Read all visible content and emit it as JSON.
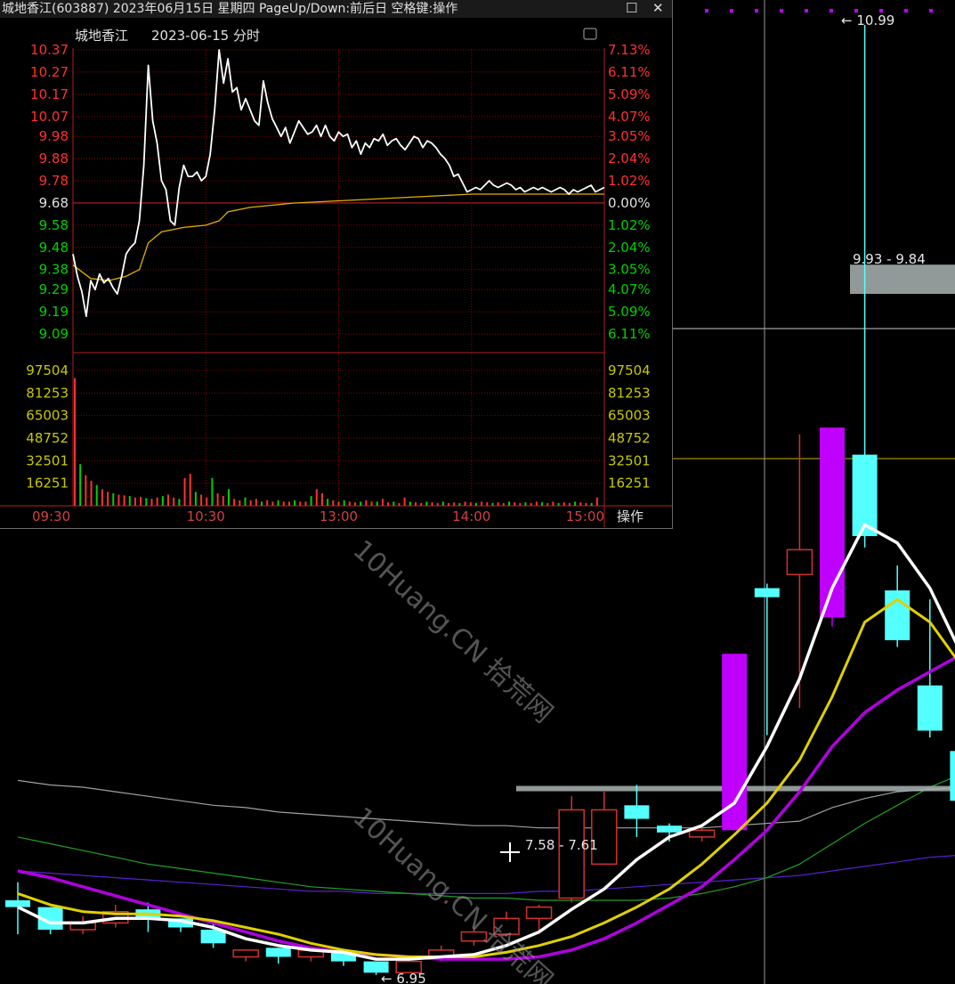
{
  "popup": {
    "title": "城地香江(603887) 2023年06月15日 星期四 PageUp/Down:前后日 空格键:操作",
    "header_name": "城地香江",
    "header_date": "2023-06-15 分时",
    "close_glyph": "✕",
    "restore_glyph": "☐",
    "op_label": "操作"
  },
  "watermark": "10Huang.CN 拾荒网",
  "colors": {
    "up": "#ff3030",
    "down": "#00d000",
    "up_candle": "#d23030",
    "down_candle": "#54ffff",
    "limit_up": "#c000ff",
    "price": "#ffffff",
    "avg": "#e0b000",
    "ma5": "#ffffff",
    "ma10": "#e0d000",
    "ma20": "#b000e0",
    "grid": "#8b0000"
  },
  "chart_data": [
    {
      "type": "line",
      "title": "城地香江 2023-06-15 分时",
      "x_ticks": [
        "09:30",
        "10:30",
        "13:00",
        "14:00",
        "15:00"
      ],
      "prev_close": 9.68,
      "price_ticks": [
        "10.37",
        "10.27",
        "10.17",
        "10.07",
        "9.98",
        "9.88",
        "9.78",
        "9.68",
        "9.58",
        "9.48",
        "9.38",
        "9.29",
        "9.19",
        "9.09"
      ],
      "pct_ticks": [
        "7.13%",
        "6.11%",
        "5.09%",
        "4.07%",
        "3.05%",
        "2.04%",
        "1.02%",
        "0.00%",
        "1.02%",
        "2.04%",
        "3.05%",
        "4.07%",
        "5.09%",
        "6.11%"
      ],
      "volume_ticks": [
        "97504",
        "81253",
        "65003",
        "48752",
        "32501",
        "16251"
      ],
      "series": [
        {
          "values": [
            [
              0,
              9.45
            ],
            [
              2,
              9.35
            ],
            [
              4,
              9.28
            ],
            [
              6,
              9.17
            ],
            [
              8,
              9.33
            ],
            [
              10,
              9.29
            ],
            [
              12,
              9.36
            ],
            [
              14,
              9.32
            ],
            [
              16,
              9.34
            ],
            [
              18,
              9.3
            ],
            [
              20,
              9.27
            ],
            [
              22,
              9.35
            ],
            [
              24,
              9.45
            ],
            [
              26,
              9.48
            ],
            [
              28,
              9.5
            ],
            [
              30,
              9.6
            ],
            [
              32,
              9.85
            ],
            [
              34,
              10.3
            ],
            [
              36,
              10.05
            ],
            [
              38,
              9.95
            ],
            [
              40,
              9.78
            ],
            [
              42,
              9.74
            ],
            [
              44,
              9.6
            ],
            [
              46,
              9.58
            ],
            [
              48,
              9.75
            ],
            [
              50,
              9.85
            ],
            [
              52,
              9.8
            ],
            [
              54,
              9.8
            ],
            [
              56,
              9.82
            ],
            [
              58,
              9.78
            ],
            [
              60,
              9.8
            ],
            [
              62,
              9.9
            ],
            [
              64,
              10.1
            ],
            [
              66,
              10.37
            ],
            [
              68,
              10.22
            ],
            [
              70,
              10.33
            ],
            [
              72,
              10.18
            ],
            [
              74,
              10.2
            ],
            [
              76,
              10.1
            ],
            [
              78,
              10.15
            ],
            [
              80,
              10.1
            ],
            [
              82,
              10.05
            ],
            [
              84,
              10.03
            ],
            [
              86,
              10.23
            ],
            [
              88,
              10.13
            ],
            [
              90,
              10.06
            ],
            [
              92,
              10.02
            ],
            [
              94,
              9.98
            ],
            [
              96,
              10.02
            ],
            [
              98,
              9.95
            ],
            [
              100,
              10.0
            ],
            [
              102,
              10.05
            ],
            [
              104,
              10.02
            ],
            [
              106,
              9.99
            ],
            [
              108,
              10.0
            ],
            [
              110,
              10.03
            ],
            [
              112,
              9.98
            ],
            [
              114,
              10.03
            ],
            [
              116,
              9.98
            ],
            [
              118,
              9.96
            ],
            [
              120,
              10.0
            ],
            [
              122,
              9.98
            ],
            [
              124,
              9.99
            ],
            [
              126,
              9.93
            ],
            [
              128,
              9.96
            ],
            [
              130,
              9.9
            ],
            [
              132,
              9.95
            ],
            [
              134,
              9.93
            ],
            [
              136,
              9.97
            ],
            [
              138,
              9.96
            ],
            [
              140,
              9.99
            ],
            [
              142,
              9.94
            ],
            [
              144,
              9.96
            ],
            [
              146,
              9.97
            ],
            [
              148,
              9.94
            ],
            [
              150,
              9.92
            ],
            [
              152,
              9.95
            ],
            [
              154,
              9.98
            ],
            [
              156,
              9.97
            ],
            [
              158,
              9.93
            ],
            [
              160,
              9.96
            ],
            [
              162,
              9.95
            ],
            [
              164,
              9.93
            ],
            [
              166,
              9.9
            ],
            [
              168,
              9.88
            ],
            [
              170,
              9.85
            ],
            [
              172,
              9.8
            ],
            [
              174,
              9.81
            ],
            [
              176,
              9.77
            ],
            [
              178,
              9.73
            ],
            [
              180,
              9.74
            ],
            [
              182,
              9.75
            ],
            [
              184,
              9.74
            ],
            [
              186,
              9.76
            ],
            [
              188,
              9.78
            ],
            [
              190,
              9.76
            ],
            [
              192,
              9.75
            ],
            [
              194,
              9.76
            ],
            [
              196,
              9.77
            ],
            [
              198,
              9.76
            ],
            [
              200,
              9.74
            ],
            [
              202,
              9.75
            ],
            [
              204,
              9.73
            ],
            [
              206,
              9.74
            ],
            [
              208,
              9.75
            ],
            [
              210,
              9.74
            ],
            [
              212,
              9.75
            ],
            [
              214,
              9.74
            ],
            [
              216,
              9.73
            ],
            [
              218,
              9.74
            ],
            [
              220,
              9.75
            ],
            [
              222,
              9.74
            ],
            [
              224,
              9.72
            ],
            [
              226,
              9.74
            ],
            [
              228,
              9.73
            ],
            [
              230,
              9.74
            ],
            [
              232,
              9.75
            ],
            [
              234,
              9.76
            ],
            [
              236,
              9.73
            ],
            [
              238,
              9.74
            ],
            [
              240,
              9.75
            ]
          ]
        },
        {
          "values": [
            [
              0,
              9.4
            ],
            [
              8,
              9.34
            ],
            [
              16,
              9.33
            ],
            [
              24,
              9.35
            ],
            [
              30,
              9.38
            ],
            [
              34,
              9.5
            ],
            [
              40,
              9.55
            ],
            [
              50,
              9.57
            ],
            [
              60,
              9.58
            ],
            [
              66,
              9.6
            ],
            [
              70,
              9.64
            ],
            [
              80,
              9.66
            ],
            [
              100,
              9.68
            ],
            [
              120,
              9.69
            ],
            [
              140,
              9.7
            ],
            [
              160,
              9.71
            ],
            [
              180,
              9.72
            ],
            [
              200,
              9.72
            ],
            [
              220,
              9.72
            ],
            [
              240,
              9.72
            ]
          ]
        }
      ],
      "volume": [
        92000,
        30000,
        22000,
        18000,
        15000,
        12000,
        10000,
        9000,
        8000,
        7500,
        7000,
        6000,
        6500,
        5500,
        5000,
        6000,
        7000,
        8000,
        6000,
        5000,
        20000,
        23000,
        10000,
        8000,
        6000,
        20000,
        9000,
        7000,
        12000,
        5000,
        4000,
        6000,
        4000,
        5000,
        3000,
        4000,
        3000,
        4000,
        3000,
        3000,
        4000,
        3000,
        3000,
        7000,
        12000,
        9000,
        5000,
        4000,
        3000,
        4000,
        3000,
        2500,
        3000,
        4000,
        3000,
        3000,
        5000,
        2500,
        3000,
        2000,
        6000,
        3000,
        2500,
        2000,
        3000,
        2500,
        2000,
        3000,
        2000,
        2500,
        2000,
        3000,
        2500,
        2000,
        3000,
        2500,
        2000,
        2500,
        2000,
        3000,
        2500,
        2000,
        2500,
        2000,
        3000,
        2500,
        2000,
        3000,
        2000,
        2500,
        2000,
        3000,
        2500,
        2000,
        2000,
        6000
      ]
    },
    {
      "type": "candlestick",
      "price_labels": [
        {
          "text": "10.99"
        },
        {
          "text": "9.93 - 9.84"
        },
        {
          "text": "7.58 - 7.61"
        },
        {
          "text": "6.95"
        }
      ],
      "candles": [
        {
          "o": 7.12,
          "c": 7.09,
          "h": 7.2,
          "l": 6.97
        },
        {
          "o": 7.09,
          "c": 6.99,
          "h": 7.09,
          "l": 6.97
        },
        {
          "o": 6.99,
          "c": 7.02,
          "h": 7.05,
          "l": 6.97
        },
        {
          "o": 7.02,
          "c": 7.07,
          "h": 7.1,
          "l": 7.0
        },
        {
          "o": 7.08,
          "c": 7.04,
          "h": 7.11,
          "l": 6.98
        },
        {
          "o": 7.04,
          "c": 7.0,
          "h": 7.04,
          "l": 6.98
        },
        {
          "o": 6.99,
          "c": 6.93,
          "h": 7.03,
          "l": 6.91
        },
        {
          "o": 6.87,
          "c": 6.9,
          "h": 6.9,
          "l": 6.85
        },
        {
          "o": 6.91,
          "c": 6.87,
          "h": 6.91,
          "l": 6.84
        },
        {
          "o": 6.87,
          "c": 6.9,
          "h": 6.91,
          "l": 6.85
        },
        {
          "o": 6.89,
          "c": 6.85,
          "h": 6.9,
          "l": 6.83
        },
        {
          "o": 6.85,
          "c": 6.8,
          "h": 6.85,
          "l": 6.79
        },
        {
          "o": 6.8,
          "c": 6.85,
          "h": 6.86,
          "l": 6.81
        },
        {
          "o": 6.86,
          "c": 6.9,
          "h": 6.92,
          "l": 6.85
        },
        {
          "o": 6.94,
          "c": 6.98,
          "h": 7.0,
          "l": 6.92
        },
        {
          "o": 6.97,
          "c": 7.04,
          "h": 7.07,
          "l": 6.96
        },
        {
          "o": 7.04,
          "c": 7.09,
          "h": 7.1,
          "l": 6.98
        },
        {
          "o": 7.13,
          "c": 7.52,
          "h": 7.58,
          "l": 7.11
        },
        {
          "o": 7.28,
          "c": 7.52,
          "h": 7.6,
          "l": 7.3
        },
        {
          "o": 7.54,
          "c": 7.48,
          "h": 7.63,
          "l": 7.4
        },
        {
          "o": 7.45,
          "c": 7.42,
          "h": 7.46,
          "l": 7.38
        },
        {
          "o": 7.4,
          "c": 7.43,
          "h": 7.45,
          "l": 7.38
        },
        {
          "o": 7.43,
          "c": 8.21,
          "h": 8.21,
          "l": 7.43
        },
        {
          "o": 8.5,
          "c": 8.46,
          "h": 8.52,
          "l": 7.85
        },
        {
          "o": 8.56,
          "c": 8.67,
          "h": 9.18,
          "l": 7.97
        },
        {
          "o": 8.37,
          "c": 9.21,
          "h": 9.21,
          "l": 8.33
        },
        {
          "o": 9.09,
          "c": 8.73,
          "h": 10.99,
          "l": 8.68
        },
        {
          "o": 8.49,
          "c": 8.27,
          "h": 8.6,
          "l": 8.24
        },
        {
          "o": 8.07,
          "c": 7.87,
          "h": 8.45,
          "l": 7.84
        },
        {
          "o": 7.78,
          "c": 7.56,
          "h": 7.7,
          "l": 7.53
        }
      ],
      "limit_up_index": [
        22,
        25
      ],
      "ma5": [
        7.09,
        7.02,
        7.02,
        7.04,
        7.04,
        7.03,
        7.0,
        6.95,
        6.92,
        6.9,
        6.89,
        6.86,
        6.86,
        6.87,
        6.88,
        6.92,
        6.98,
        7.08,
        7.17,
        7.3,
        7.4,
        7.45,
        7.55,
        7.8,
        8.1,
        8.5,
        8.78,
        8.7,
        8.5,
        8.2
      ],
      "ma10": [
        7.15,
        7.1,
        7.07,
        7.06,
        7.06,
        7.05,
        7.03,
        7.0,
        6.97,
        6.93,
        6.9,
        6.88,
        6.87,
        6.87,
        6.87,
        6.89,
        6.92,
        6.96,
        7.02,
        7.09,
        7.17,
        7.28,
        7.41,
        7.55,
        7.74,
        8.02,
        8.35,
        8.45,
        8.35,
        8.15
      ],
      "ma20": [
        7.25,
        7.22,
        7.18,
        7.14,
        7.1,
        7.06,
        7.02,
        6.98,
        6.94,
        6.91,
        6.89,
        6.88,
        6.87,
        6.86,
        6.86,
        6.86,
        6.87,
        6.9,
        6.95,
        7.02,
        7.1,
        7.18,
        7.3,
        7.43,
        7.6,
        7.8,
        7.95,
        8.05,
        8.13,
        8.21
      ],
      "ma_long": [
        7.4,
        7.37,
        7.34,
        7.31,
        7.28,
        7.26,
        7.24,
        7.22,
        7.2,
        7.18,
        7.17,
        7.16,
        7.15,
        7.14,
        7.13,
        7.13,
        7.12,
        7.12,
        7.12,
        7.12,
        7.13,
        7.15,
        7.18,
        7.22,
        7.28,
        7.37,
        7.46,
        7.54,
        7.62,
        7.68
      ],
      "ma_gray": [
        7.65,
        7.63,
        7.62,
        7.6,
        7.58,
        7.56,
        7.54,
        7.53,
        7.51,
        7.5,
        7.49,
        7.48,
        7.47,
        7.46,
        7.45,
        7.45,
        7.44,
        7.44,
        7.44,
        7.44,
        7.44,
        7.44,
        7.45,
        7.46,
        7.47,
        7.53,
        7.57,
        7.6,
        7.61,
        7.62
      ],
      "ma_purple": [
        7.25,
        7.24,
        7.23,
        7.22,
        7.21,
        7.2,
        7.19,
        7.18,
        7.17,
        7.16,
        7.16,
        7.15,
        7.15,
        7.15,
        7.15,
        7.15,
        7.16,
        7.16,
        7.17,
        7.18,
        7.19,
        7.2,
        7.21,
        7.22,
        7.23,
        7.25,
        7.27,
        7.29,
        7.31,
        7.32
      ]
    }
  ]
}
